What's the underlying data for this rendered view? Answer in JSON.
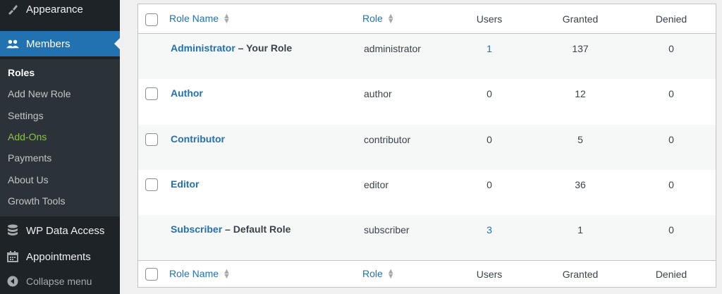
{
  "sidebar": {
    "appearance": {
      "label": "Appearance",
      "icon": "paintbrush-icon"
    },
    "members": {
      "label": "Members",
      "icon": "members-icon"
    },
    "submenu": [
      {
        "label": "Roles",
        "active": true
      },
      {
        "label": "Add New Role"
      },
      {
        "label": "Settings"
      },
      {
        "label": "Add-Ons",
        "highlight": "#8bc34a"
      },
      {
        "label": "Payments"
      },
      {
        "label": "About Us"
      },
      {
        "label": "Growth Tools"
      }
    ],
    "wp_data_access": {
      "label": "WP Data Access",
      "icon": "database-icon"
    },
    "appointments": {
      "label": "Appointments",
      "icon": "calendar-icon"
    },
    "collapse": {
      "label": "Collapse menu",
      "icon": "collapse-icon"
    }
  },
  "table": {
    "columns": {
      "role_name": "Role Name",
      "role": "Role",
      "users": "Users",
      "granted": "Granted",
      "denied": "Denied"
    },
    "rows": [
      {
        "name": "Administrator",
        "suffix": " – Your Role",
        "role": "administrator",
        "users": "1",
        "granted": "137",
        "denied": "0",
        "checkbox": false
      },
      {
        "name": "Author",
        "suffix": "",
        "role": "author",
        "users": "0",
        "granted": "12",
        "denied": "0",
        "checkbox": true
      },
      {
        "name": "Contributor",
        "suffix": "",
        "role": "contributor",
        "users": "0",
        "granted": "5",
        "denied": "0",
        "checkbox": true
      },
      {
        "name": "Editor",
        "suffix": "",
        "role": "editor",
        "users": "0",
        "granted": "36",
        "denied": "0",
        "checkbox": true
      },
      {
        "name": "Subscriber",
        "suffix": " – Default Role",
        "role": "subscriber",
        "users": "3",
        "granted": "1",
        "denied": "0",
        "checkbox": false
      }
    ]
  },
  "colors": {
    "accent": "#2271b1",
    "sidebar_bg": "#1d2327",
    "submenu_bg": "#2c3338"
  }
}
